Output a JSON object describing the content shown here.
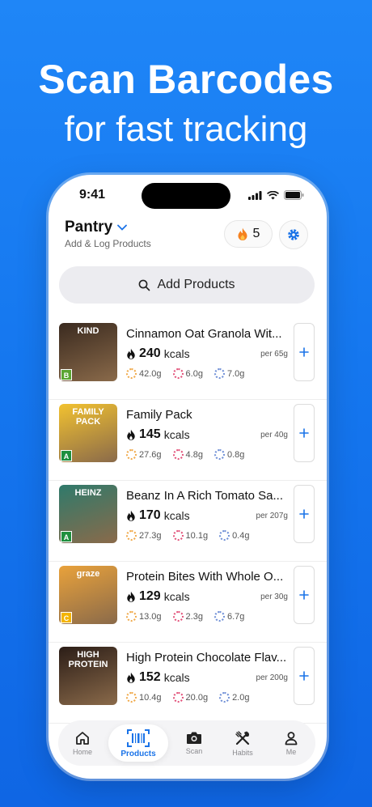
{
  "promo": {
    "headline": "Scan Barcodes",
    "subline": "for fast tracking"
  },
  "status": {
    "time": "9:41"
  },
  "header": {
    "title": "Pantry",
    "subtitle": "Add & Log Products",
    "streak_count": "5"
  },
  "search": {
    "label": "Add Products"
  },
  "products": [
    {
      "name": "Cinnamon Oat Granola Wit...",
      "kcal": "240",
      "kcal_unit": "kcals",
      "per": "per 65g",
      "carbs": "42.0g",
      "protein": "6.0g",
      "fat": "7.0g",
      "grade": "B",
      "grade_color": "#5aa531",
      "thumb_label": "KIND",
      "thumb_color": "#3a2a1f"
    },
    {
      "name": "Family Pack",
      "kcal": "145",
      "kcal_unit": "kcals",
      "per": "per 40g",
      "carbs": "27.6g",
      "protein": "4.8g",
      "fat": "0.8g",
      "grade": "A",
      "grade_color": "#1e8f3e",
      "thumb_label": "FAMILY PACK",
      "thumb_color": "#f2c230"
    },
    {
      "name": "Beanz In A Rich Tomato Sa...",
      "kcal": "170",
      "kcal_unit": "kcals",
      "per": "per 207g",
      "carbs": "27.3g",
      "protein": "10.1g",
      "fat": "0.4g",
      "grade": "A",
      "grade_color": "#1e8f3e",
      "thumb_label": "HEINZ",
      "thumb_color": "#2f7a6b"
    },
    {
      "name": "Protein Bites With Whole O...",
      "kcal": "129",
      "kcal_unit": "kcals",
      "per": "per 30g",
      "carbs": "13.0g",
      "protein": "2.3g",
      "fat": "6.7g",
      "grade": "C",
      "grade_color": "#f4b400",
      "thumb_label": "graze",
      "thumb_color": "#e9a23b"
    },
    {
      "name": "High Protein Chocolate Flav...",
      "kcal": "152",
      "kcal_unit": "kcals",
      "per": "per 200g",
      "carbs": "10.4g",
      "protein": "20.0g",
      "fat": "2.0g",
      "grade": "",
      "grade_color": "",
      "thumb_label": "HIGH PROTEIN",
      "thumb_color": "#2b1d17"
    }
  ],
  "tabs": [
    {
      "label": "Home",
      "icon": "home-icon"
    },
    {
      "label": "Products",
      "icon": "barcode-icon"
    },
    {
      "label": "Scan",
      "icon": "camera-icon"
    },
    {
      "label": "Habits",
      "icon": "habits-icon"
    },
    {
      "label": "Me",
      "icon": "person-icon"
    }
  ],
  "colors": {
    "accent": "#1a73e8",
    "background": "#1677ef",
    "flame": "#f5811f",
    "carbs_ring": "#f0a94a",
    "protein_ring": "#e2527a",
    "fat_ring": "#6f8fd6"
  }
}
